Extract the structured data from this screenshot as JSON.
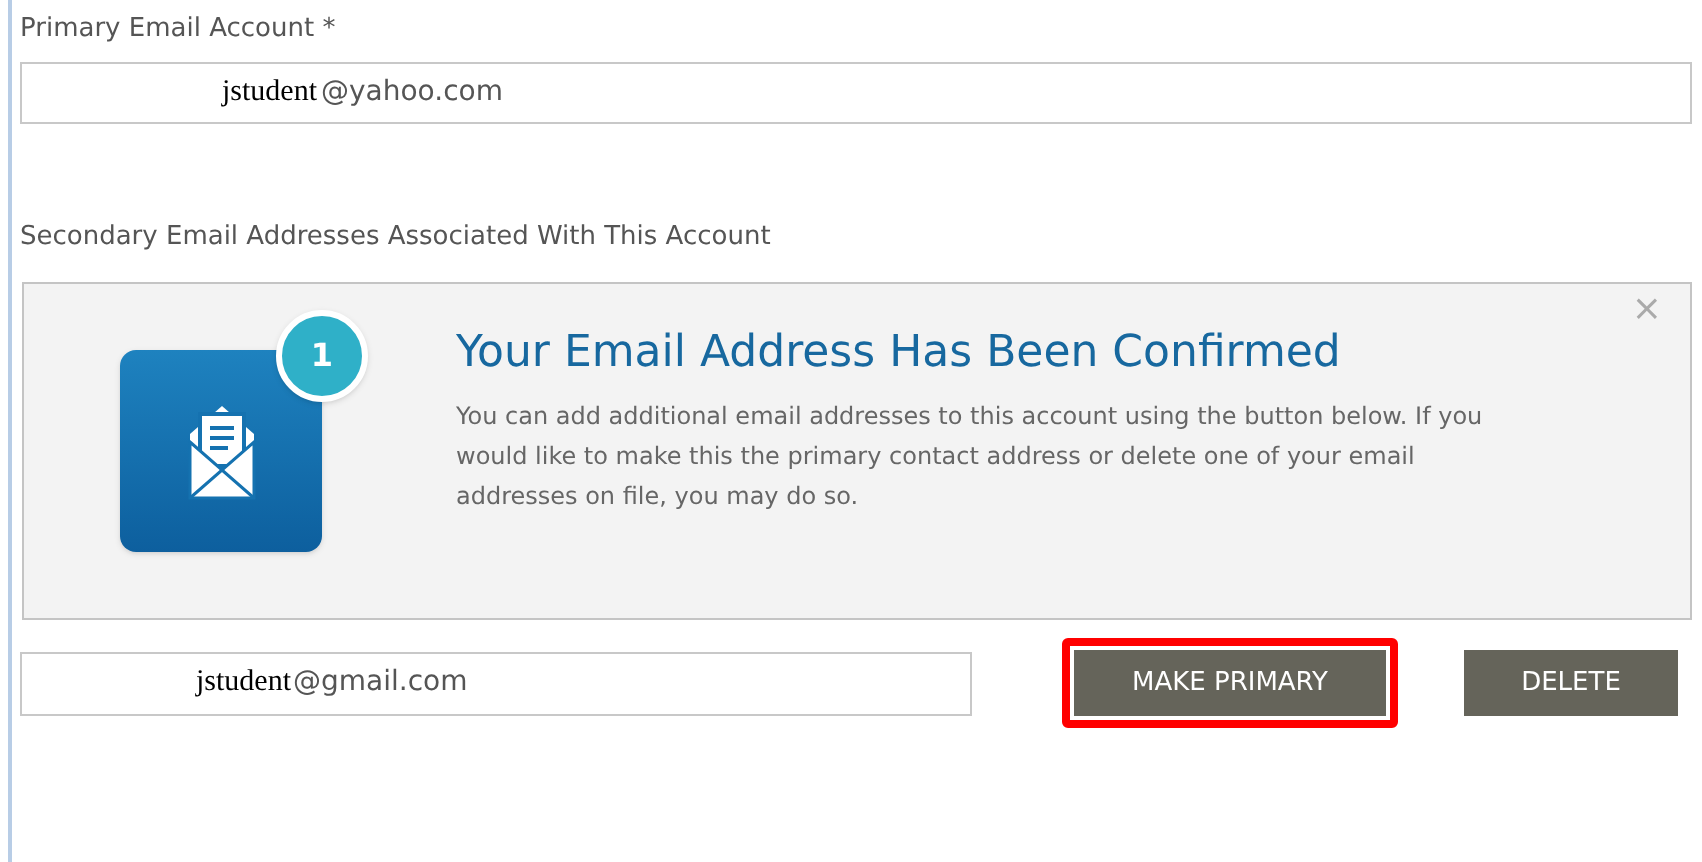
{
  "primary_email": {
    "label": "Primary Email Account *",
    "value_user": "jstudent",
    "value_domain": "@yahoo.com"
  },
  "secondary_heading": "Secondary Email Addresses Associated With This Account",
  "notice": {
    "badge": "1",
    "title": "Your Email Address Has Been Confirmed",
    "body": "You can add additional email addresses to this account using the button below. If you would like to make this the primary contact address or delete one of your email addresses on file, you may do so.",
    "close": "×"
  },
  "secondary_emails": [
    {
      "value_user": "jstudent",
      "value_domain": "@gmail.com"
    }
  ],
  "buttons": [
    {
      "label": "MAKE PRIMARY",
      "highlighted": true
    },
    {
      "label": "DELETE",
      "highlighted": false
    }
  ]
}
